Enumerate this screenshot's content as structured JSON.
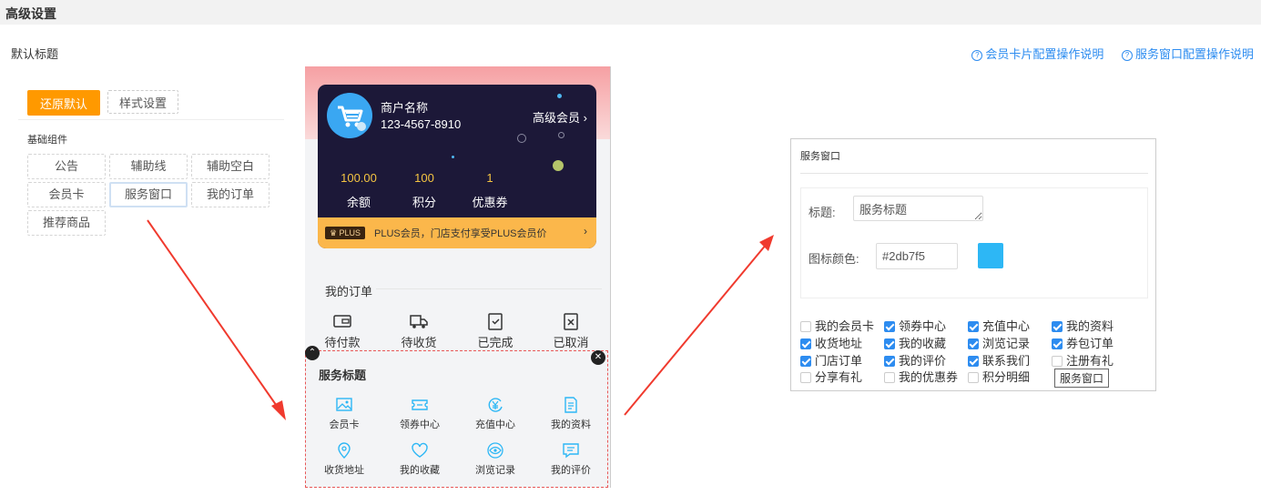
{
  "header": {
    "title": "高级设置"
  },
  "page_heading": "默认标题",
  "help_links": [
    {
      "label": "会员卡片配置操作说明",
      "icon": "question-circle-icon"
    },
    {
      "label": "服务窗口配置操作说明",
      "icon": "question-circle-icon"
    }
  ],
  "left_panel": {
    "restore_label": "还原默认",
    "style_label": "样式设置",
    "group_label": "基础组件",
    "components": [
      "公告",
      "辅助线",
      "辅助空白",
      "会员卡",
      "服务窗口",
      "我的订单",
      "推荐商品"
    ],
    "active_component": "服务窗口"
  },
  "phone": {
    "card": {
      "merchant_name": "商户名称",
      "phone": "123-4567-8910",
      "level": "高级会员",
      "stats": [
        {
          "value": "100.00",
          "label": "余额"
        },
        {
          "value": "100",
          "label": "积分"
        },
        {
          "value": "1",
          "label": "优惠券"
        }
      ],
      "plus_badge": "PLUS",
      "plus_text": "PLUS会员，门店支付享受PLUS会员价",
      "colors": {
        "card_bg": "#1c1838",
        "value": "#f5c542",
        "plus_bar": "#fbb74b",
        "avatar": "#3aa7f2"
      }
    },
    "orders": {
      "title": "我的订单",
      "items": [
        {
          "label": "待付款",
          "icon": "wallet-icon"
        },
        {
          "label": "待收货",
          "icon": "truck-icon"
        },
        {
          "label": "已完成",
          "icon": "clipboard-check-icon"
        },
        {
          "label": "已取消",
          "icon": "clipboard-x-icon"
        }
      ]
    },
    "service": {
      "title": "服务标题",
      "items": [
        {
          "label": "会员卡",
          "icon": "image-card-icon"
        },
        {
          "label": "领券中心",
          "icon": "ticket-icon"
        },
        {
          "label": "充值中心",
          "icon": "yen-refresh-icon"
        },
        {
          "label": "我的资料",
          "icon": "document-icon"
        },
        {
          "label": "收货地址",
          "icon": "location-pin-icon"
        },
        {
          "label": "我的收藏",
          "icon": "heart-icon"
        },
        {
          "label": "浏览记录",
          "icon": "eye-icon"
        },
        {
          "label": "我的评价",
          "icon": "comment-icon"
        }
      ]
    }
  },
  "right_panel": {
    "title": "服务窗口",
    "title_label": "标题:",
    "title_value": "服务标题",
    "color_label": "图标颜色:",
    "color_value": "#2db7f5",
    "swatch_color": "#2db7f5",
    "checkboxes": [
      {
        "label": "我的会员卡",
        "checked": false
      },
      {
        "label": "领券中心",
        "checked": true
      },
      {
        "label": "充值中心",
        "checked": true
      },
      {
        "label": "我的资料",
        "checked": true
      },
      {
        "label": "收货地址",
        "checked": true
      },
      {
        "label": "我的收藏",
        "checked": true
      },
      {
        "label": "浏览记录",
        "checked": true
      },
      {
        "label": "券包订单",
        "checked": true
      },
      {
        "label": "门店订单",
        "checked": true
      },
      {
        "label": "我的评价",
        "checked": true
      },
      {
        "label": "联系我们",
        "checked": true
      },
      {
        "label": "注册有礼",
        "checked": false
      },
      {
        "label": "分享有礼",
        "checked": false
      },
      {
        "label": "我的优惠券",
        "checked": false
      },
      {
        "label": "积分明细",
        "checked": false
      }
    ],
    "tooltip": "服务窗口"
  },
  "colors": {
    "accent": "#2d8cf0",
    "orange": "#ff9900",
    "arrow": "#f03a2e",
    "service_icon": "#2db7f5"
  }
}
